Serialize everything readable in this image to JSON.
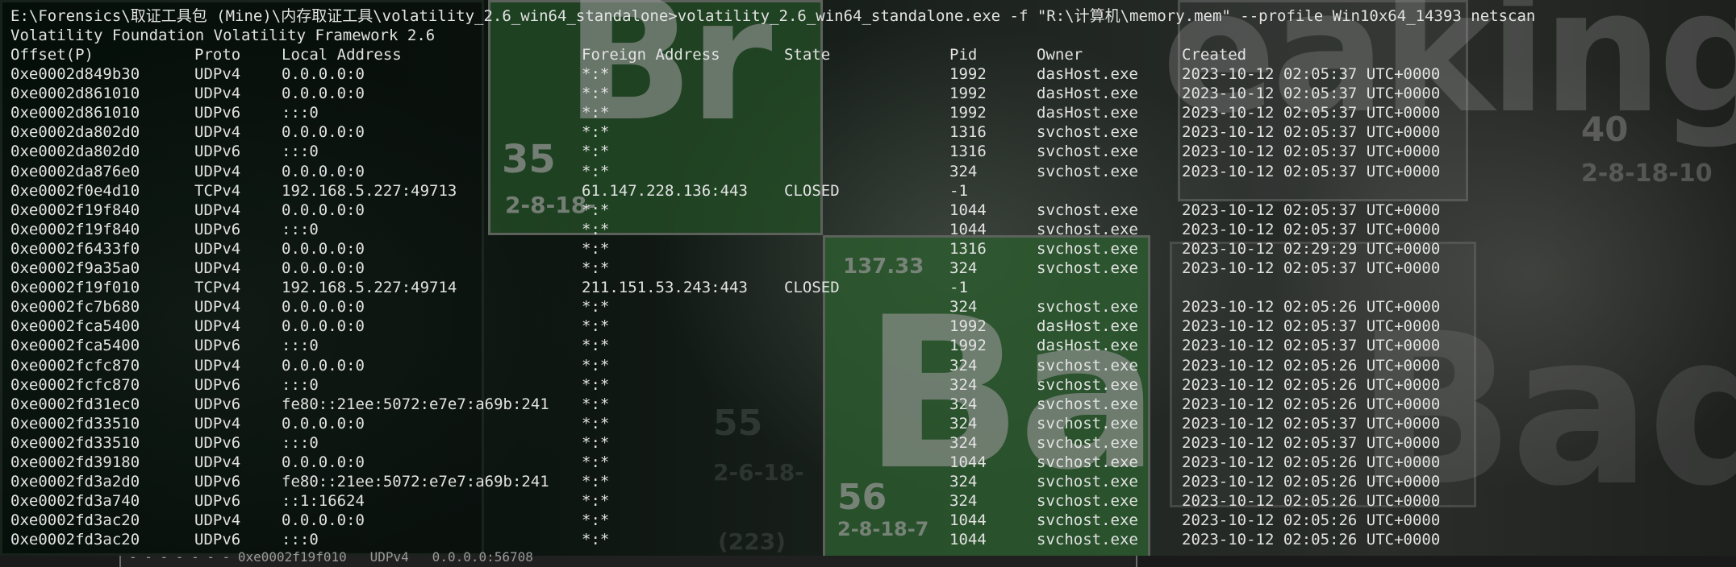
{
  "command_line": "E:\\Forensics\\取证工具包 (Mine)\\内存取证工具\\volatility_2.6_win64_standalone>volatility_2.6_win64_standalone.exe -f \"R:\\计算机\\memory.mem\" --profile Win10x64_14393 netscan",
  "banner": "Volatility Foundation Volatility Framework 2.6",
  "columns": {
    "offset": "Offset(P)",
    "proto": "Proto",
    "local": "Local Address",
    "foreign": "Foreign Address",
    "state": "State",
    "pid": "Pid",
    "owner": "Owner",
    "created": "Created"
  },
  "rows": [
    {
      "offset": "0xe0002d849b30",
      "proto": "UDPv4",
      "local": "0.0.0.0:0",
      "foreign": "*:*",
      "state": "",
      "pid": "1992",
      "owner": "dasHost.exe",
      "created": "2023-10-12 02:05:37 UTC+0000"
    },
    {
      "offset": "0xe0002d861010",
      "proto": "UDPv4",
      "local": "0.0.0.0:0",
      "foreign": "*:*",
      "state": "",
      "pid": "1992",
      "owner": "dasHost.exe",
      "created": "2023-10-12 02:05:37 UTC+0000"
    },
    {
      "offset": "0xe0002d861010",
      "proto": "UDPv6",
      "local": ":::0",
      "foreign": "*:*",
      "state": "",
      "pid": "1992",
      "owner": "dasHost.exe",
      "created": "2023-10-12 02:05:37 UTC+0000"
    },
    {
      "offset": "0xe0002da802d0",
      "proto": "UDPv4",
      "local": "0.0.0.0:0",
      "foreign": "*:*",
      "state": "",
      "pid": "1316",
      "owner": "svchost.exe",
      "created": "2023-10-12 02:05:37 UTC+0000"
    },
    {
      "offset": "0xe0002da802d0",
      "proto": "UDPv6",
      "local": ":::0",
      "foreign": "*:*",
      "state": "",
      "pid": "1316",
      "owner": "svchost.exe",
      "created": "2023-10-12 02:05:37 UTC+0000"
    },
    {
      "offset": "0xe0002da876e0",
      "proto": "UDPv4",
      "local": "0.0.0.0:0",
      "foreign": "*:*",
      "state": "",
      "pid": "324",
      "owner": "svchost.exe",
      "created": "2023-10-12 02:05:37 UTC+0000"
    },
    {
      "offset": "0xe0002f0e4d10",
      "proto": "TCPv4",
      "local": "192.168.5.227:49713",
      "foreign": "61.147.228.136:443",
      "state": "CLOSED",
      "pid": "-1",
      "owner": "",
      "created": ""
    },
    {
      "offset": "0xe0002f19f840",
      "proto": "UDPv4",
      "local": "0.0.0.0:0",
      "foreign": "*:*",
      "state": "",
      "pid": "1044",
      "owner": "svchost.exe",
      "created": "2023-10-12 02:05:37 UTC+0000"
    },
    {
      "offset": "0xe0002f19f840",
      "proto": "UDPv6",
      "local": ":::0",
      "foreign": "*:*",
      "state": "",
      "pid": "1044",
      "owner": "svchost.exe",
      "created": "2023-10-12 02:05:37 UTC+0000"
    },
    {
      "offset": "0xe0002f6433f0",
      "proto": "UDPv4",
      "local": "0.0.0.0:0",
      "foreign": "*:*",
      "state": "",
      "pid": "1316",
      "owner": "svchost.exe",
      "created": "2023-10-12 02:29:29 UTC+0000"
    },
    {
      "offset": "0xe0002f9a35a0",
      "proto": "UDPv4",
      "local": "0.0.0.0:0",
      "foreign": "*:*",
      "state": "",
      "pid": "324",
      "owner": "svchost.exe",
      "created": "2023-10-12 02:05:37 UTC+0000"
    },
    {
      "offset": "0xe0002f19f010",
      "proto": "TCPv4",
      "local": "192.168.5.227:49714",
      "foreign": "211.151.53.243:443",
      "state": "CLOSED",
      "pid": "-1",
      "owner": "",
      "created": ""
    },
    {
      "offset": "0xe0002fc7b680",
      "proto": "UDPv4",
      "local": "0.0.0.0:0",
      "foreign": "*:*",
      "state": "",
      "pid": "324",
      "owner": "svchost.exe",
      "created": "2023-10-12 02:05:26 UTC+0000"
    },
    {
      "offset": "0xe0002fca5400",
      "proto": "UDPv4",
      "local": "0.0.0.0:0",
      "foreign": "*:*",
      "state": "",
      "pid": "1992",
      "owner": "dasHost.exe",
      "created": "2023-10-12 02:05:37 UTC+0000"
    },
    {
      "offset": "0xe0002fca5400",
      "proto": "UDPv6",
      "local": ":::0",
      "foreign": "*:*",
      "state": "",
      "pid": "1992",
      "owner": "dasHost.exe",
      "created": "2023-10-12 02:05:37 UTC+0000"
    },
    {
      "offset": "0xe0002fcfc870",
      "proto": "UDPv4",
      "local": "0.0.0.0:0",
      "foreign": "*:*",
      "state": "",
      "pid": "324",
      "owner": "svchost.exe",
      "created": "2023-10-12 02:05:26 UTC+0000"
    },
    {
      "offset": "0xe0002fcfc870",
      "proto": "UDPv6",
      "local": ":::0",
      "foreign": "*:*",
      "state": "",
      "pid": "324",
      "owner": "svchost.exe",
      "created": "2023-10-12 02:05:26 UTC+0000"
    },
    {
      "offset": "0xe0002fd31ec0",
      "proto": "UDPv6",
      "local": "fe80::21ee:5072:e7e7:a69b:241",
      "foreign": "*:*",
      "state": "",
      "pid": "324",
      "owner": "svchost.exe",
      "created": "2023-10-12 02:05:26 UTC+0000"
    },
    {
      "offset": "0xe0002fd33510",
      "proto": "UDPv4",
      "local": "0.0.0.0:0",
      "foreign": "*:*",
      "state": "",
      "pid": "324",
      "owner": "svchost.exe",
      "created": "2023-10-12 02:05:37 UTC+0000"
    },
    {
      "offset": "0xe0002fd33510",
      "proto": "UDPv6",
      "local": ":::0",
      "foreign": "*:*",
      "state": "",
      "pid": "324",
      "owner": "svchost.exe",
      "created": "2023-10-12 02:05:37 UTC+0000"
    },
    {
      "offset": "0xe0002fd39180",
      "proto": "UDPv4",
      "local": "0.0.0.0:0",
      "foreign": "*:*",
      "state": "",
      "pid": "1044",
      "owner": "svchost.exe",
      "created": "2023-10-12 02:05:26 UTC+0000"
    },
    {
      "offset": "0xe0002fd3a2d0",
      "proto": "UDPv6",
      "local": "fe80::21ee:5072:e7e7:a69b:241",
      "foreign": "*:*",
      "state": "",
      "pid": "324",
      "owner": "svchost.exe",
      "created": "2023-10-12 02:05:26 UTC+0000"
    },
    {
      "offset": "0xe0002fd3a740",
      "proto": "UDPv6",
      "local": "::1:16624",
      "foreign": "*:*",
      "state": "",
      "pid": "324",
      "owner": "svchost.exe",
      "created": "2023-10-12 02:05:26 UTC+0000"
    },
    {
      "offset": "0xe0002fd3ac20",
      "proto": "UDPv4",
      "local": "0.0.0.0:0",
      "foreign": "*:*",
      "state": "",
      "pid": "1044",
      "owner": "svchost.exe",
      "created": "2023-10-12 02:05:26 UTC+0000"
    },
    {
      "offset": "0xe0002fd3ac20",
      "proto": "UDPv6",
      "local": ":::0",
      "foreign": "*:*",
      "state": "",
      "pid": "1044",
      "owner": "svchost.exe",
      "created": "2023-10-12 02:05:26 UTC+0000"
    }
  ],
  "wallpaper": {
    "tile_br_letters": "Br",
    "tile_br_number": "35",
    "tile_br_config": "2-8-18-",
    "tile_ba_letters": "Ba",
    "tile_ba_number": "56",
    "tile_ba_config": "2-8-18-7",
    "tile_ba_mass": "137.33",
    "ghost_letters_1": "eaking",
    "ghost_letters_2": "Bad",
    "ghost_number_1": "40",
    "ghost_config_1": "2-8-18-10",
    "ghost_number_2": "55",
    "ghost_config_2": "2-6-18-",
    "ghost_mass_2": "(223)",
    "colors": {
      "tile_green": "#2c5c2e",
      "tile_border": "#5d615c"
    }
  },
  "bottom_peek": "- - - - - - - 0xe0002f19f010   UDPv4   0.0.0.0:56708"
}
